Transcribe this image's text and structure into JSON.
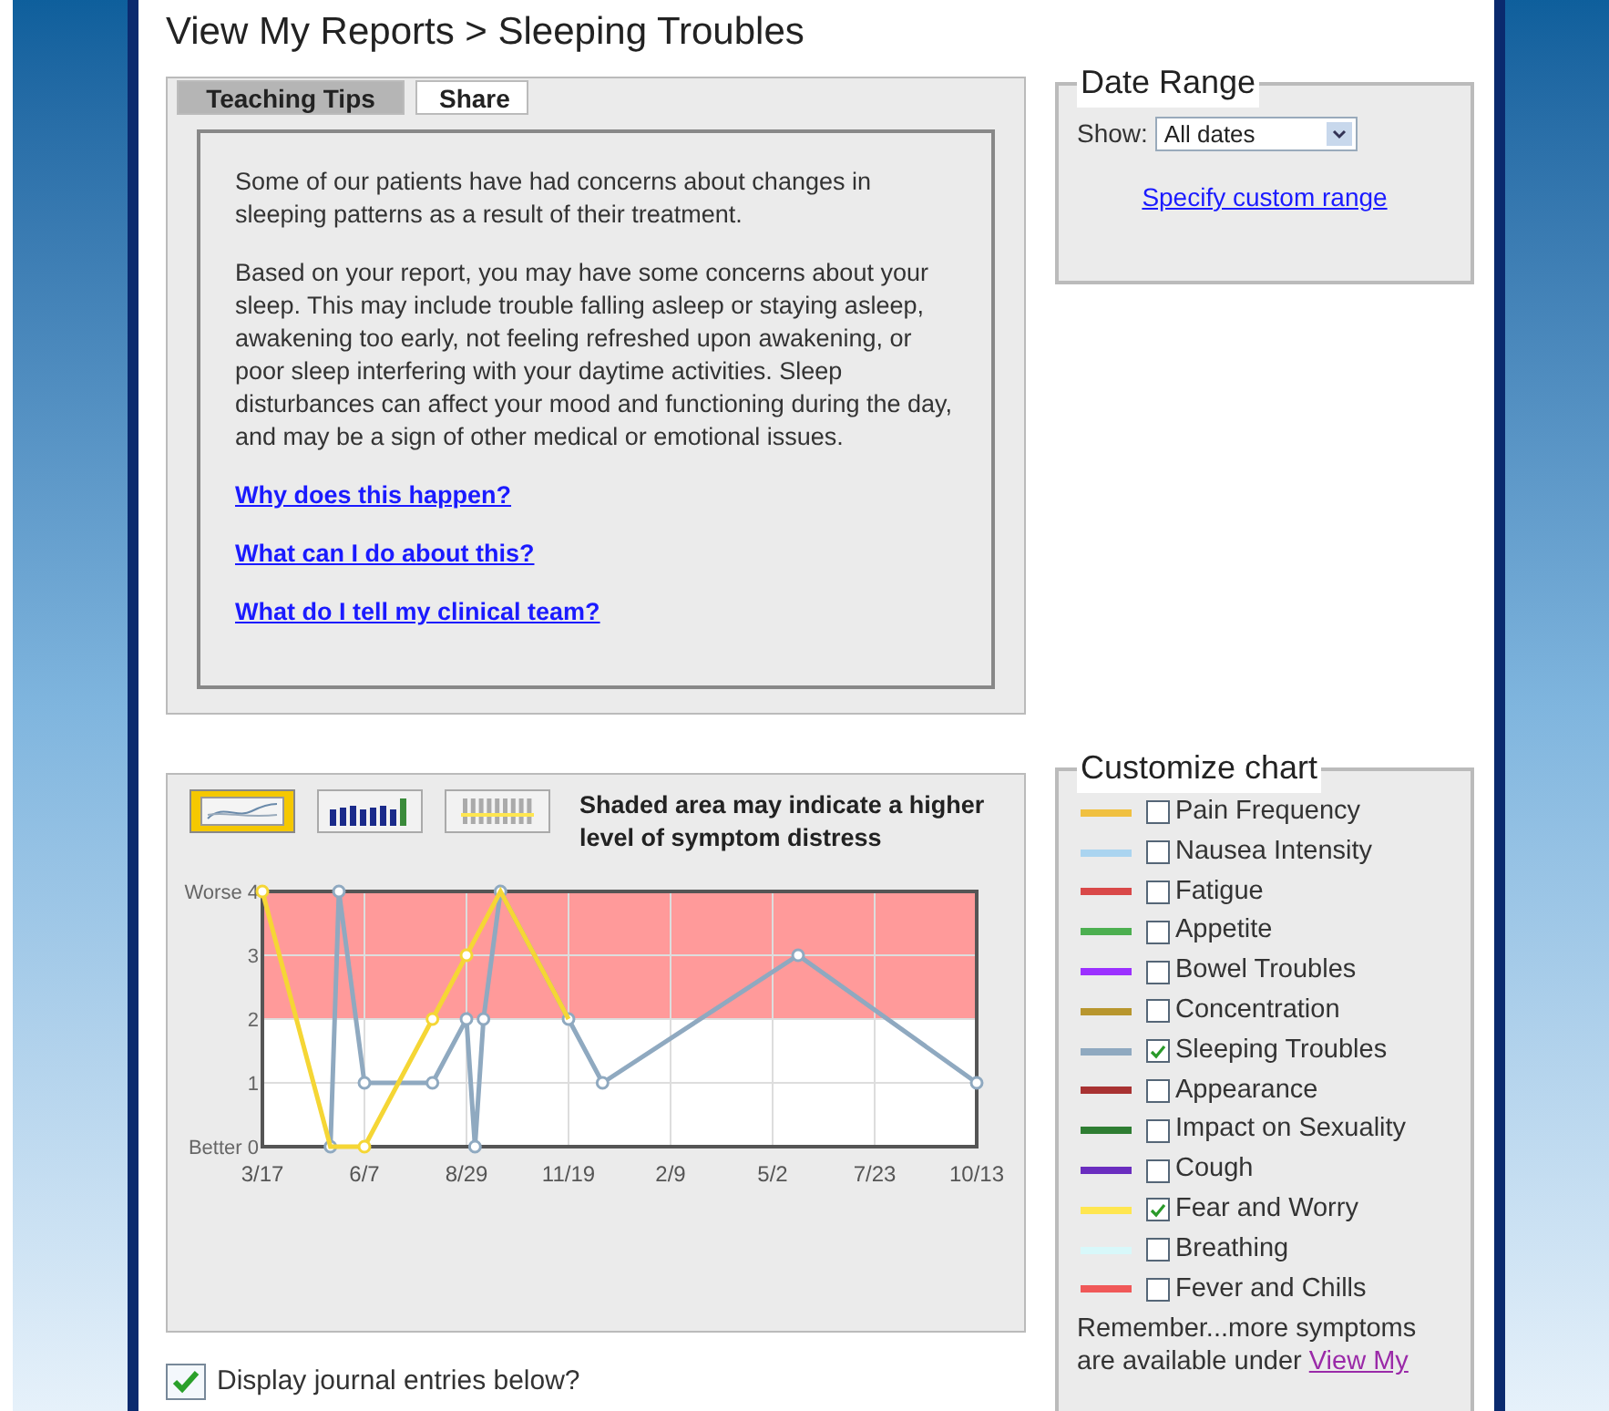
{
  "page_title": "View My Reports > Sleeping Troubles",
  "tabs": [
    {
      "label": "Teaching Tips",
      "selected": true
    },
    {
      "label": "Share",
      "selected": false
    }
  ],
  "tips": {
    "paragraphs": [
      "Some of our patients have had concerns about changes in sleeping patterns as a result of their treatment.",
      "Based on your report, you may have some concerns about your sleep. This may include trouble falling asleep or staying asleep, awakening too early, not feeling refreshed upon awakening, or poor sleep interfering with your daytime activities. Sleep disturbances can affect your mood and functioning during the day, and may be a sign of other medical or emotional issues."
    ],
    "links": [
      "Why does this happen?",
      "What can I do about this?",
      "What do I tell my clinical team?"
    ]
  },
  "date_range": {
    "title": "Date Range",
    "show_label": "Show:",
    "select_value": "All dates",
    "custom_link": "Specify custom range"
  },
  "chart_panel": {
    "view_buttons": [
      {
        "kind": "line",
        "selected": true
      },
      {
        "kind": "bar",
        "selected": false
      },
      {
        "kind": "strip",
        "selected": false
      }
    ],
    "note": "Shaded area may indicate a higher level of symptom distress",
    "chart_data": {
      "type": "line",
      "grid": true,
      "ylim": [
        0,
        4
      ],
      "categories": [
        "3/17",
        null,
        null,
        null,
        null,
        null,
        null,
        null,
        null,
        null,
        null,
        null,
        "6/7",
        null,
        null,
        null,
        null,
        null,
        null,
        null,
        null,
        null,
        null,
        null,
        "8/29",
        null,
        null,
        null,
        null,
        null,
        null,
        null,
        null,
        null,
        null,
        null,
        "11/19",
        null,
        null,
        null,
        null,
        null,
        null,
        null,
        null,
        null,
        null,
        null,
        "2/9",
        null,
        null,
        null,
        null,
        null,
        null,
        null,
        null,
        null,
        null,
        null,
        "5/2",
        null,
        null,
        null,
        null,
        null,
        null,
        null,
        null,
        null,
        null,
        null,
        "7/23",
        null,
        null,
        null,
        null,
        null,
        null,
        null,
        null,
        null,
        null,
        null,
        "10/13"
      ],
      "yticks": [
        {
          "value": 0,
          "label": "Better 0"
        },
        1,
        2,
        3,
        {
          "value": 4,
          "label": "Worse 4"
        }
      ],
      "bands": [
        {
          "axis": "y",
          "from": 2,
          "to": 4,
          "color": "#ff9a9a"
        }
      ],
      "series": [
        {
          "color": "#8fa9c0",
          "marker": "circle",
          "values": [
            null,
            null,
            null,
            null,
            null,
            null,
            null,
            null,
            0,
            4,
            null,
            null,
            1,
            null,
            null,
            null,
            null,
            null,
            null,
            null,
            1,
            null,
            null,
            null,
            2,
            0,
            2,
            null,
            4,
            null,
            null,
            null,
            null,
            null,
            null,
            null,
            2,
            null,
            null,
            null,
            1,
            null,
            null,
            null,
            null,
            null,
            null,
            null,
            null,
            null,
            null,
            null,
            null,
            null,
            null,
            null,
            null,
            null,
            null,
            null,
            null,
            null,
            null,
            3,
            null,
            null,
            null,
            null,
            null,
            null,
            null,
            null,
            null,
            null,
            null,
            null,
            null,
            null,
            null,
            null,
            null,
            null,
            null,
            null,
            1
          ]
        },
        {
          "color": "#f5d635",
          "marker": "circle",
          "values": [
            4,
            null,
            null,
            null,
            null,
            null,
            null,
            null,
            0,
            null,
            null,
            null,
            0,
            null,
            null,
            null,
            null,
            null,
            null,
            null,
            2,
            null,
            null,
            null,
            3,
            null,
            null,
            null,
            4,
            null,
            null,
            null,
            null,
            null,
            null,
            null,
            2,
            null,
            null,
            null,
            null,
            null,
            null,
            null,
            null,
            null,
            null,
            null,
            null,
            null,
            null,
            null,
            null,
            null,
            null,
            null,
            null,
            null,
            null,
            null,
            null,
            null,
            null,
            null,
            null,
            null,
            null,
            null,
            null,
            null,
            null,
            null,
            null,
            null,
            null,
            null,
            null,
            null,
            null,
            null,
            null,
            null,
            null,
            null,
            null
          ]
        }
      ]
    }
  },
  "customize": {
    "title": "Customize chart",
    "items": [
      {
        "label": "Pain Frequency",
        "color": "#f0c040",
        "checked": false
      },
      {
        "label": "Nausea Intensity",
        "color": "#aad4f0",
        "checked": false
      },
      {
        "label": "Fatigue",
        "color": "#d94848",
        "checked": false
      },
      {
        "label": "Appetite",
        "color": "#4caf50",
        "checked": false
      },
      {
        "label": "Bowel Troubles",
        "color": "#9b30ff",
        "checked": false
      },
      {
        "label": "Concentration",
        "color": "#b8962e",
        "checked": false
      },
      {
        "label": "Sleeping Troubles",
        "color": "#8fa9c0",
        "checked": true
      },
      {
        "label": "Appearance",
        "color": "#a83232",
        "checked": false
      },
      {
        "label": "Impact on Sexuality",
        "color": "#2e7d32",
        "checked": false
      },
      {
        "label": "Cough",
        "color": "#6a2dbf",
        "checked": false
      },
      {
        "label": "Fear and Worry",
        "color": "#ffe650",
        "checked": true
      },
      {
        "label": "Breathing",
        "color": "#d8f8fa",
        "checked": false
      },
      {
        "label": "Fever and Chills",
        "color": "#f05858",
        "checked": false
      }
    ],
    "note": "Remember...more symptoms are available under ",
    "note_link": "View My"
  },
  "journal": {
    "label": "Display journal entries below?",
    "checked": true
  }
}
